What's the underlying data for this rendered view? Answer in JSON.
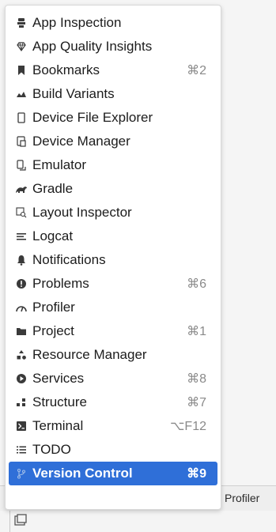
{
  "menu": {
    "items": [
      {
        "label": "App Inspection",
        "shortcut": "",
        "icon": "app-inspection-icon"
      },
      {
        "label": "App Quality Insights",
        "shortcut": "",
        "icon": "diamond-icon"
      },
      {
        "label": "Bookmarks",
        "shortcut": "⌘2",
        "icon": "bookmark-icon"
      },
      {
        "label": "Build Variants",
        "shortcut": "",
        "icon": "build-variants-icon"
      },
      {
        "label": "Device File Explorer",
        "shortcut": "",
        "icon": "device-file-icon"
      },
      {
        "label": "Device Manager",
        "shortcut": "",
        "icon": "device-manager-icon"
      },
      {
        "label": "Emulator",
        "shortcut": "",
        "icon": "emulator-icon"
      },
      {
        "label": "Gradle",
        "shortcut": "",
        "icon": "gradle-icon"
      },
      {
        "label": "Layout Inspector",
        "shortcut": "",
        "icon": "layout-inspector-icon"
      },
      {
        "label": "Logcat",
        "shortcut": "",
        "icon": "logcat-icon"
      },
      {
        "label": "Notifications",
        "shortcut": "",
        "icon": "bell-icon"
      },
      {
        "label": "Problems",
        "shortcut": "⌘6",
        "icon": "problems-icon"
      },
      {
        "label": "Profiler",
        "shortcut": "",
        "icon": "gauge-icon"
      },
      {
        "label": "Project",
        "shortcut": "⌘1",
        "icon": "folder-icon"
      },
      {
        "label": "Resource Manager",
        "shortcut": "",
        "icon": "resource-manager-icon"
      },
      {
        "label": "Services",
        "shortcut": "⌘8",
        "icon": "services-icon"
      },
      {
        "label": "Structure",
        "shortcut": "⌘7",
        "icon": "structure-icon"
      },
      {
        "label": "Terminal",
        "shortcut": "⌥F12",
        "icon": "terminal-icon"
      },
      {
        "label": "TODO",
        "shortcut": "",
        "icon": "todo-list-icon"
      },
      {
        "label": "Version Control",
        "shortcut": "⌘9",
        "icon": "branch-icon"
      }
    ],
    "selected_index": 19
  },
  "bottom": {
    "tab_label": "Profiler"
  },
  "colors": {
    "selection": "#2f6fd8",
    "text": "#1c1c1c",
    "shortcut": "#8a8a8a"
  }
}
